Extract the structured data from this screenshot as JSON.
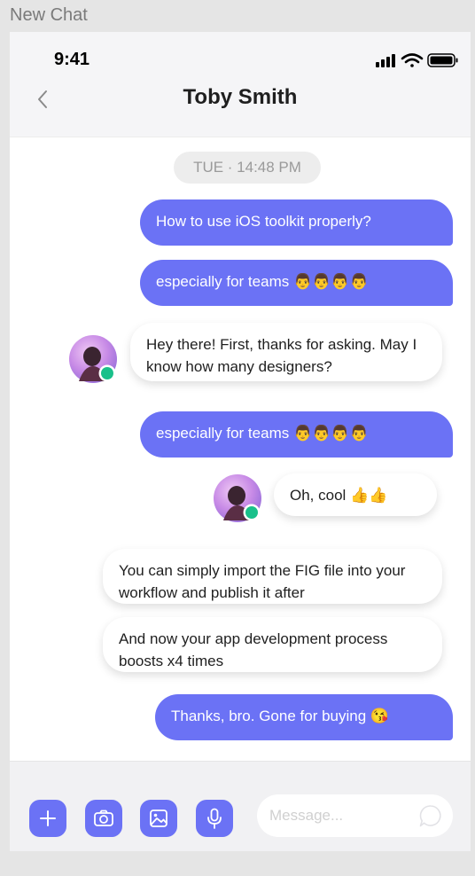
{
  "frame": {
    "label": "New Chat"
  },
  "status_bar": {
    "time": "9:41",
    "icons": [
      "signal-icon",
      "wifi-icon",
      "battery-icon"
    ]
  },
  "header": {
    "title": "Toby Smith",
    "back_icon": "chevron-left-icon"
  },
  "chat": {
    "date_label": "TUE · 14:48 PM",
    "messages": [
      {
        "direction": "out",
        "text": "How to use iOS toolkit properly?"
      },
      {
        "direction": "out",
        "text": "especially for teams 👨👨👨👨"
      },
      {
        "direction": "in",
        "text": "Hey there! First, thanks for asking. May I know how many designers?",
        "avatar": true
      },
      {
        "direction": "out",
        "text": "especially for teams 👨👨👨👨"
      },
      {
        "direction": "in",
        "text": "Oh, cool 👍👍",
        "avatar": true
      },
      {
        "direction": "in",
        "text": "You can simply import the FIG file into your workflow and publish it after"
      },
      {
        "direction": "in",
        "text": "And now your app development process boosts x4 times"
      },
      {
        "direction": "out",
        "text": "Thanks, bro. Gone for buying 😘"
      }
    ]
  },
  "composer": {
    "placeholder": "Message...",
    "tools": [
      "plus-icon",
      "camera-icon",
      "image-icon",
      "microphone-icon"
    ],
    "send_icon": "chat-bubble-icon"
  },
  "colors": {
    "accent": "#6b72f5",
    "online": "#19c08a",
    "background": "#e5e5e5"
  }
}
